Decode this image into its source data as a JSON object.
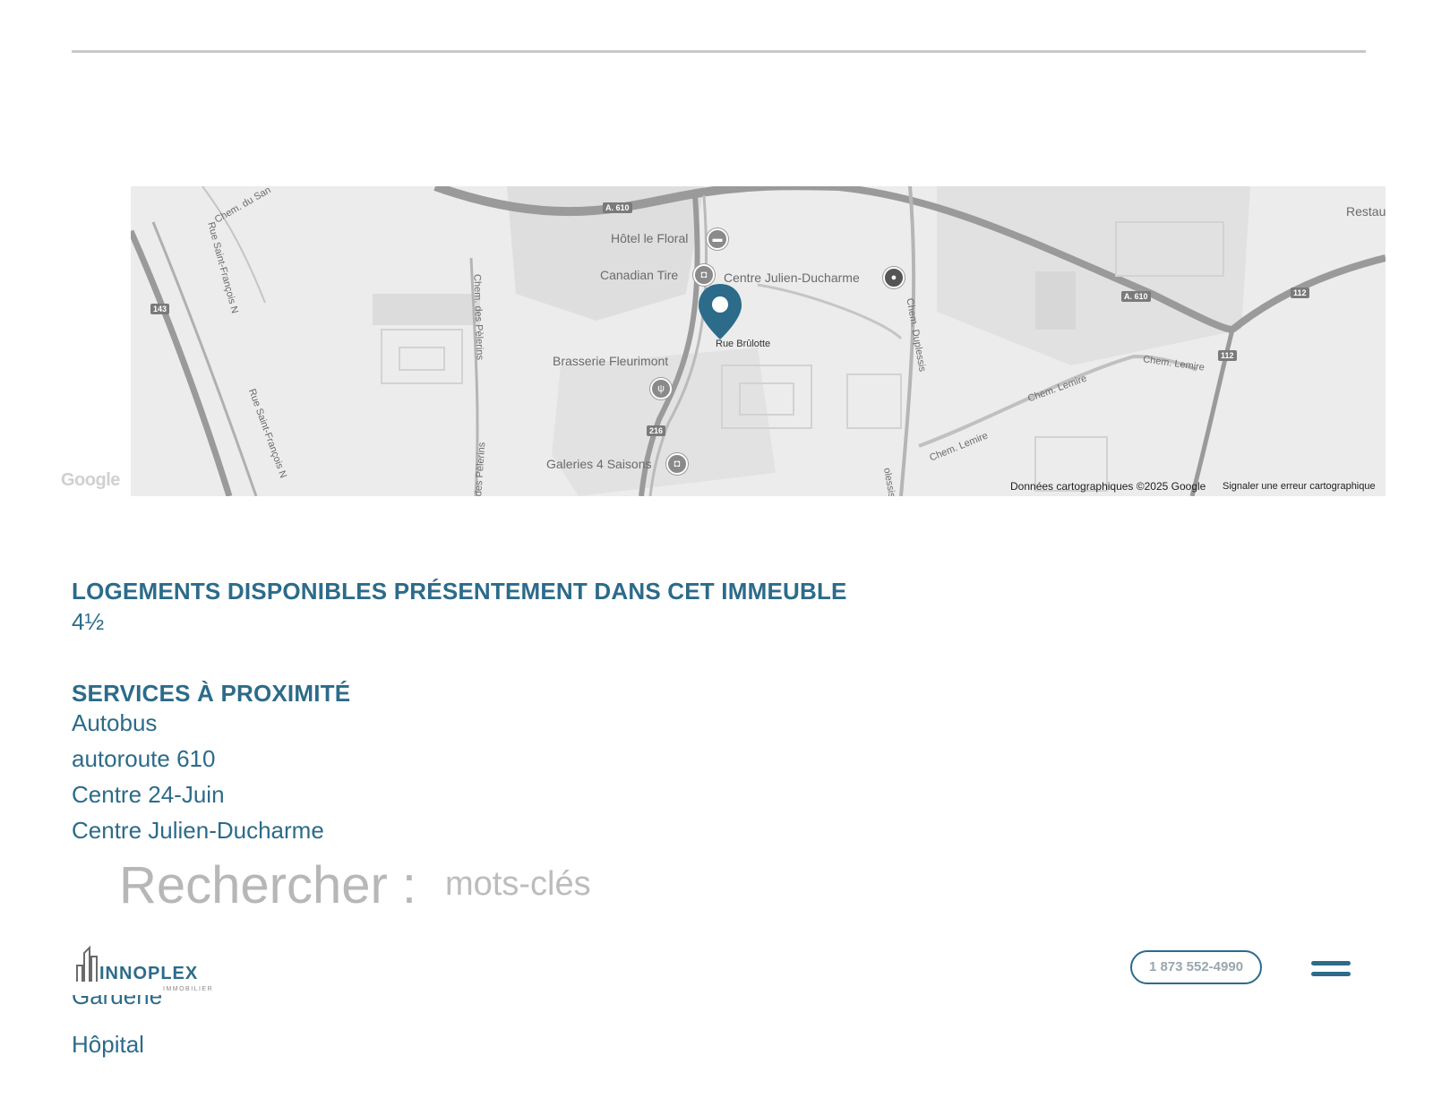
{
  "map": {
    "labels": {
      "hotel": "Hôtel le Floral",
      "canadian_tire": "Canadian Tire",
      "centre_julien": "Centre Julien-Ducharme",
      "brasserie": "Brasserie Fleurimont",
      "galeries": "Galeries 4 Saisons",
      "rue_brulotte": "Rue Brûlotte",
      "chem_lemire_1": "Chem. Lemire",
      "chem_lemire_2": "Chem. Lemire",
      "chem_lemire_3": "Chem. Lemire",
      "chem_duplessis": "Chem. Duplessis",
      "chem_pelerins": "Chem. des Pèlerins",
      "chem_pelerins_2": "des Pèlerins",
      "rue_st_francois": "Rue Saint-François N",
      "rue_st_francois_2": "Rue Saint-François N",
      "chem_du_san": "Chem. du San",
      "restau": "Restau",
      "olessis": "olessis"
    },
    "shields": {
      "a610_top": "A. 610",
      "a610_right": "A. 610",
      "r112_top": "112",
      "r112_bottom": "112",
      "r143": "143",
      "r216": "216"
    },
    "google_logo": "Google",
    "attribution": "Données cartographiques ©2025 Google",
    "report_link": "Signaler une erreur cartographique",
    "marker_color": "#2c6b8a"
  },
  "available": {
    "title": "LOGEMENTS DISPONIBLES PRÉSENTEMENT DANS CET IMMEUBLE",
    "units": "4½"
  },
  "services": {
    "title": "SERVICES À PROXIMITÉ",
    "items": [
      "Autobus",
      "autoroute 610",
      "Centre 24-Juin",
      "Centre Julien-Ducharme"
    ],
    "partial_item": "Garderie",
    "last_item": "Hôpital"
  },
  "search": {
    "label": "Rechercher :",
    "placeholder": "mots-clés"
  },
  "header": {
    "logo_name": "INNOPLEX",
    "logo_sub": "IMMOBILIER",
    "phone": "1 873 552-4990"
  },
  "colors": {
    "brand": "#2c6b8a",
    "map_bg": "#ebebeb",
    "road": "#9a9a9a"
  }
}
